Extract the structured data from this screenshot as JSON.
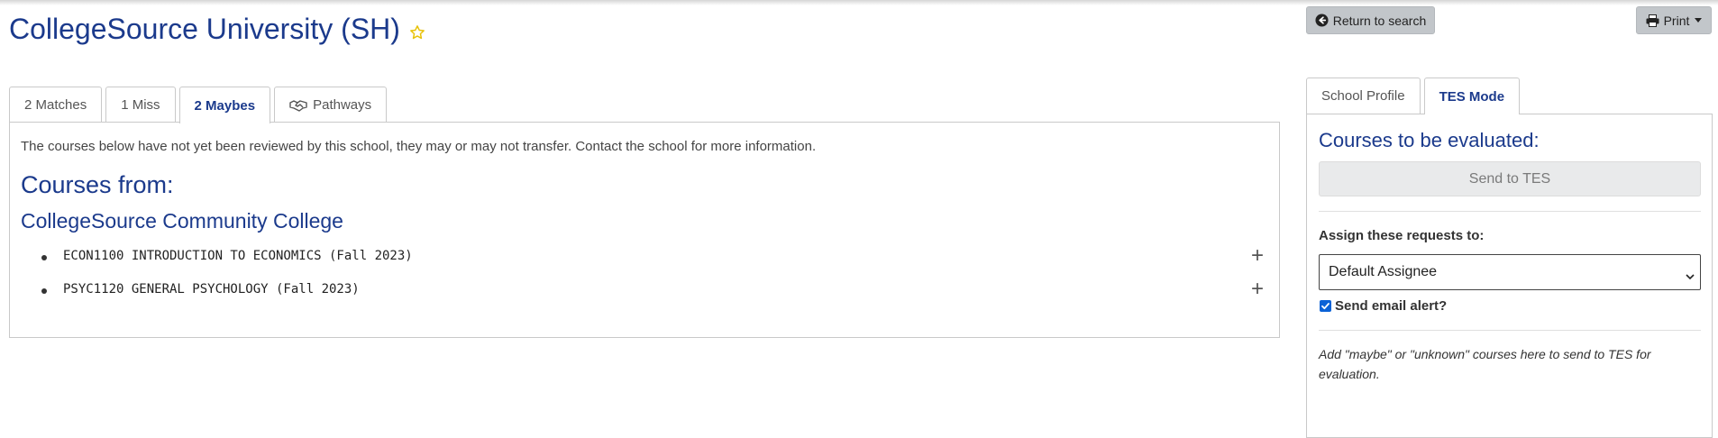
{
  "page": {
    "title": "CollegeSource University (SH)",
    "favorite_icon": "star-outline-icon"
  },
  "header_actions": {
    "return_label": "Return to search",
    "return_icon": "arrow-circle-left-icon",
    "print_label": "Print",
    "print_icon": "printer-icon"
  },
  "result_tabs": [
    {
      "label": "2 Matches",
      "active": false
    },
    {
      "label": "1 Miss",
      "active": false
    },
    {
      "label": "2 Maybes",
      "active": true
    },
    {
      "label": "Pathways",
      "active": false,
      "icon": "handshake-icon"
    }
  ],
  "maybes": {
    "notice": "The courses below have not yet been reviewed by this school, they may or may not transfer. Contact the school for more information.",
    "courses_from_label": "Courses from:",
    "school_name": "CollegeSource Community College",
    "courses": [
      {
        "text": "ECON1100 INTRODUCTION TO ECONOMICS (Fall 2023)"
      },
      {
        "text": "PSYC1120 GENERAL PSYCHOLOGY (Fall 2023)"
      }
    ],
    "expand_glyph": "+"
  },
  "side_tabs": [
    {
      "label": "School Profile",
      "active": false
    },
    {
      "label": "TES Mode",
      "active": true
    }
  ],
  "tes": {
    "title": "Courses to be evaluated:",
    "send_label": "Send to TES",
    "assign_label": "Assign these requests to:",
    "assignee_selected": "Default Assignee",
    "email_alert_label": "Send email alert?",
    "email_alert_checked": true,
    "help_text": "Add \"maybe\" or \"unknown\" courses here to send to TES for evaluation."
  },
  "colors": {
    "heading_blue": "#1b3a8c",
    "star_yellow": "#e8c20a",
    "button_gray": "#c2c6ca",
    "checkbox_blue": "#0b62d6"
  }
}
